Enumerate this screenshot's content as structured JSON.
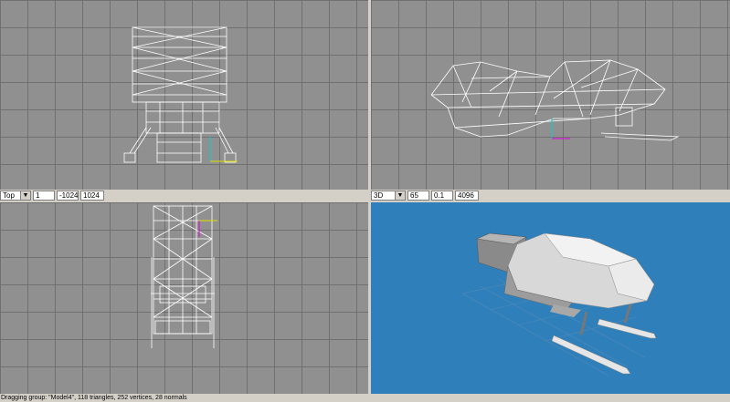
{
  "viewports": {
    "top_left": {
      "name": "front-wire"
    },
    "top_right": {
      "name": "side-wire"
    },
    "bottom_left": {
      "name": "top-wire"
    },
    "bottom_right": {
      "name": "3d-shaded"
    }
  },
  "toolbar_left": {
    "view_select": "Top",
    "field1": "1",
    "field2": "-1024",
    "field3": "1024"
  },
  "toolbar_right": {
    "view_select": "3D",
    "field1": "65",
    "field2": "0.1",
    "field3": "4096"
  },
  "status_bar": {
    "text": "Dragging group: \"Model4\", 118 triangles, 252 vertices, 28 normals"
  },
  "colors": {
    "grid_bg": "#909090",
    "grid_line": "#707070",
    "viewport_3d_bg": "#2f7fbb",
    "wire": "#ffffff"
  }
}
